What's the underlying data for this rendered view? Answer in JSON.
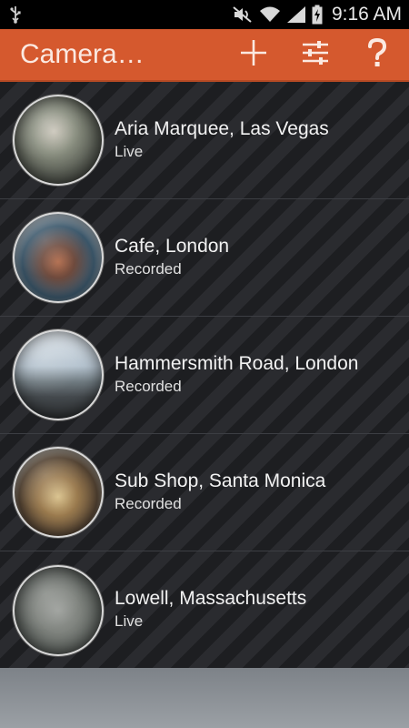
{
  "status_bar": {
    "time": "9:16 AM",
    "icons": [
      "usb-icon",
      "mute-icon",
      "wifi-icon",
      "signal-icon",
      "battery-charging-icon"
    ]
  },
  "action_bar": {
    "title": "Camera…",
    "actions": [
      "add-icon",
      "settings-sliders-icon",
      "help-icon"
    ],
    "color": "#d5592e"
  },
  "cameras": [
    {
      "name": "Aria Marquee, Las Vegas",
      "status": "Live"
    },
    {
      "name": "Cafe, London",
      "status": "Recorded"
    },
    {
      "name": "Hammersmith Road, London",
      "status": "Recorded"
    },
    {
      "name": "Sub Shop, Santa Monica",
      "status": "Recorded"
    },
    {
      "name": "Lowell, Massachusetts",
      "status": "Live"
    }
  ]
}
